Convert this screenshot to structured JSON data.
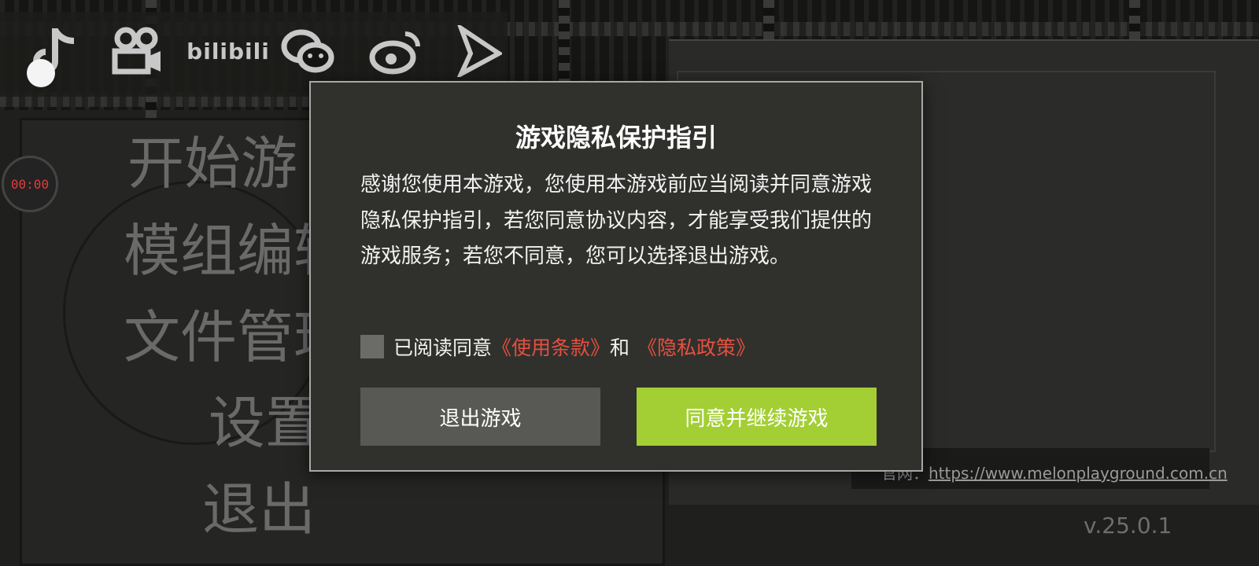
{
  "overlay": {
    "record_timer": "00:00",
    "social_icons": [
      "tiktok-icon",
      "video-camera-icon",
      "bilibili-icon",
      "wechat-icon",
      "weibo-icon",
      "play-arrow-icon"
    ],
    "bilibili_text": "bilibili"
  },
  "menu": {
    "start_game": "开始游",
    "mod_editor": "模组编辑",
    "file_manager": "文件管理",
    "settings": "设置",
    "exit": "退出"
  },
  "footer": {
    "url_prefix": "官网：",
    "url": "https://www.melonplayground.com.cn",
    "version": "v.25.0.1"
  },
  "dialog": {
    "title": "游戏隐私保护指引",
    "body": "感谢您使用本游戏，您使用本游戏前应当阅读并同意游戏隐私保护指引，若您同意协议内容，才能享受我们提供的游戏服务；若您不同意，您可以选择退出游戏。",
    "agree_prefix": "已阅读同意",
    "terms_link": "《使用条款》",
    "conjunction": "和",
    "privacy_link": "《隐私政策》",
    "exit_button": "退出游戏",
    "agree_button": "同意并继续游戏",
    "checkbox_checked": false
  },
  "colors": {
    "agree_button": "#a3cf34",
    "exit_button": "#585855",
    "link": "#e5503f",
    "timer_text": "#e23b3b"
  }
}
